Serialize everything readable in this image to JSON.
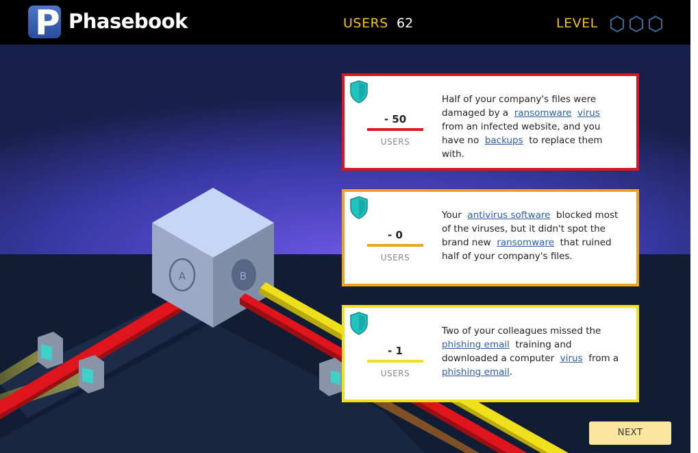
{
  "header": {
    "logo_letter": "P",
    "brand": "Phasebook",
    "users_label": "USERS",
    "users_value": "62",
    "level_label": "LEVEL",
    "level_hexes": 3
  },
  "cube": {
    "face_a_label": "A",
    "face_b_label": "B"
  },
  "cards": [
    {
      "delta": "- 50",
      "units": "USERS",
      "accent": "#e0141c",
      "line1_before": "Half of your company's files were",
      "line2_before": "damaged by a",
      "link_ransomware": "ransomware",
      "link_virus": "virus",
      "line3": "from an infected website, and you",
      "line4_before": "have no",
      "link_backups": "backups",
      "line4_after": "to replace them",
      "line5": "with."
    },
    {
      "delta": "- 0",
      "units": "USERS",
      "accent": "#f0a21c",
      "line1_before": "Your",
      "link_antivirus": "antivirus software",
      "line1_after": "blocked most",
      "line2": "of the viruses, but it didn't spot the",
      "line3_before": "brand new",
      "link_ransomware": "ransomware",
      "line3_after": "that ruined",
      "line4": "half of your company's files."
    },
    {
      "delta": "- 1",
      "units": "USERS",
      "accent": "#f0e01c",
      "line1": "Two of your colleagues missed the",
      "link_phishing1": "phishing email",
      "line2_after": "training and",
      "line3_before": "downloaded a computer",
      "link_virus": "virus",
      "line3_after": "from a",
      "link_phishing2": "phishing email",
      "line4_after": "."
    }
  ],
  "next_button": "NEXT",
  "colors": {
    "accent_yellow": "#f5c21b",
    "red_pipe": "#e0141c",
    "yellow_pipe": "#f0e01c"
  }
}
